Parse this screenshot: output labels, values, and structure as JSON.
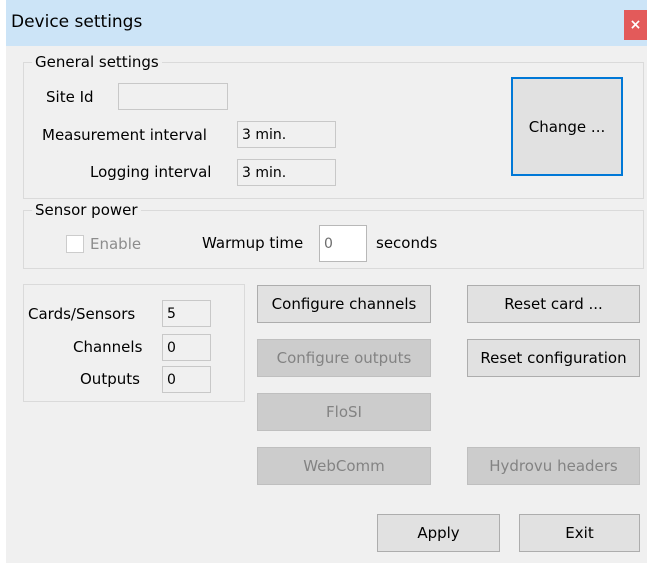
{
  "window": {
    "title": "Device settings",
    "close_glyph": "×"
  },
  "general": {
    "title": "General settings",
    "site_id_label": "Site Id",
    "site_id_value": "",
    "measurement_label": "Measurement interval",
    "measurement_value": "3 min.",
    "logging_label": "Logging interval",
    "logging_value": "3 min.",
    "change_button": "Change ..."
  },
  "sensor_power": {
    "title": "Sensor power",
    "enable_label": "Enable",
    "enable_checked": false,
    "warmup_label": "Warmup time",
    "warmup_value": "0",
    "seconds_label": "seconds"
  },
  "info": {
    "cards_label": "Cards/Sensors",
    "cards_value": "5",
    "channels_label": "Channels",
    "channels_value": "0",
    "outputs_label": "Outputs",
    "outputs_value": "0"
  },
  "buttons": {
    "configure_channels": "Configure channels",
    "reset_card": "Reset card ...",
    "configure_outputs": "Configure outputs",
    "reset_configuration": "Reset configuration",
    "flosi": "FloSI",
    "webcomm": "WebComm",
    "hydrovu_headers": "Hydrovu headers",
    "apply": "Apply",
    "exit": "Exit"
  }
}
